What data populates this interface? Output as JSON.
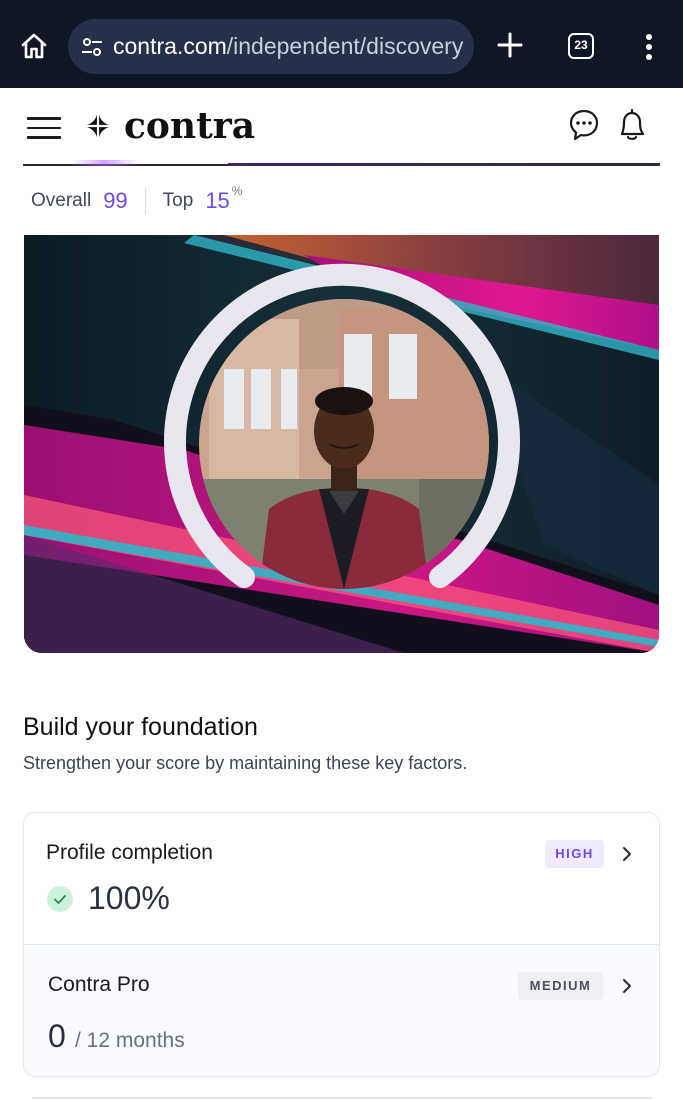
{
  "browser": {
    "url_host": "contra.com",
    "url_path": "/independent/discovery",
    "tab_count": "23",
    "icons": [
      "home-icon",
      "site-settings-icon",
      "new-tab-icon",
      "tabs-icon",
      "more-icon"
    ]
  },
  "header": {
    "logo_text": "contra",
    "icons": [
      "menu-icon",
      "logo-mark-icon",
      "messages-icon",
      "notifications-icon"
    ]
  },
  "score": {
    "overall_label": "Overall",
    "overall_value": "99",
    "top_label": "Top",
    "top_value": "15",
    "top_unit": "%"
  },
  "foundation": {
    "title": "Build your foundation",
    "subtitle": "Strengthen your score by maintaining these key factors.",
    "items": [
      {
        "title": "Profile completion",
        "badge": "HIGH",
        "value": "100%",
        "progress": 1.0
      },
      {
        "title": "Contra Pro",
        "badge": "MEDIUM",
        "value": "0",
        "suffix": "/ 12 months",
        "progress": 0.0
      }
    ]
  },
  "colors": {
    "accent": "#6a4ae8",
    "browser_bg": "#0f1626",
    "success_bg": "#cdf2dc"
  }
}
